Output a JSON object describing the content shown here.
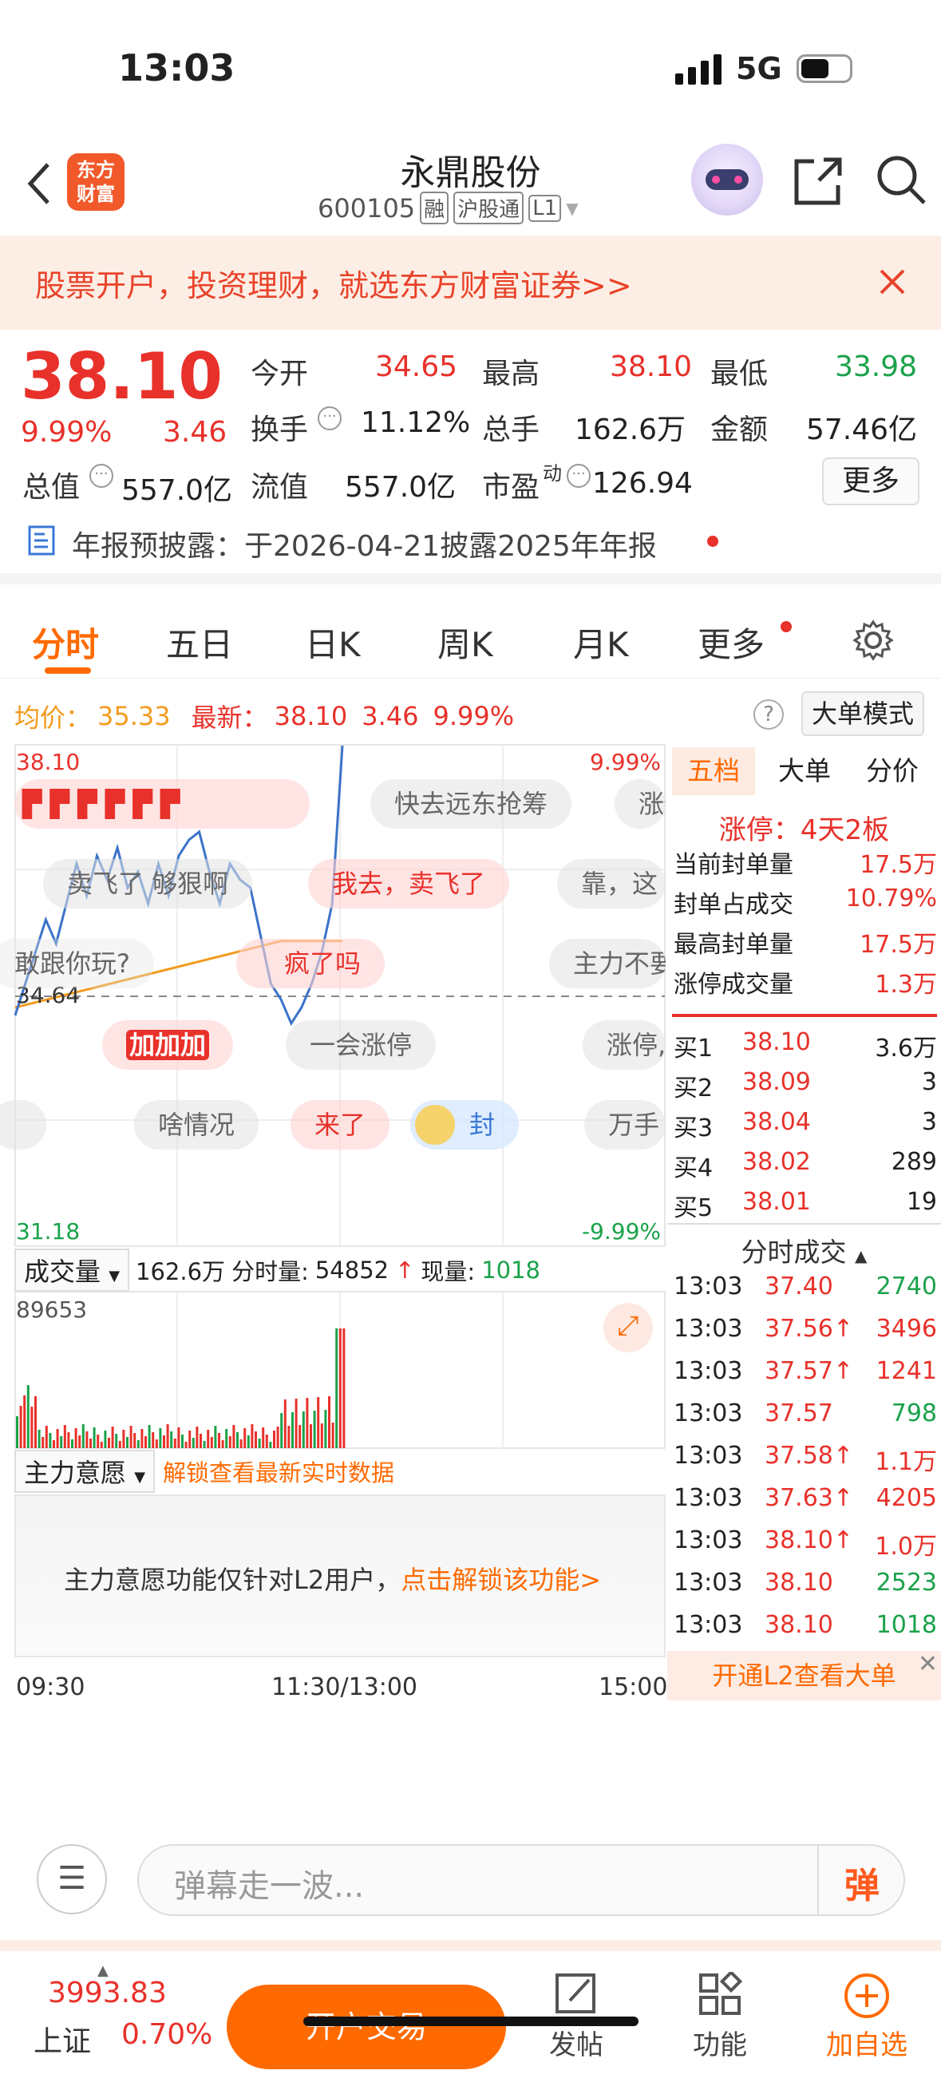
{
  "status": {
    "time": "13:03",
    "network": "5G"
  },
  "header": {
    "logo": "东方\n财富",
    "logo_line1": "东方",
    "logo_line2": "财富",
    "stock_name": "永鼎股份",
    "stock_code": "600105",
    "tags": [
      "融",
      "沪股通",
      "L1"
    ]
  },
  "banner": {
    "text": "股票开户，投资理财，就选东方财富证券>>"
  },
  "quote": {
    "price": "38.10",
    "pct": "9.99%",
    "change": "3.46",
    "fields": {
      "open_label": "今开",
      "open": "34.65",
      "high_label": "最高",
      "high": "38.10",
      "low_label": "最低",
      "low": "33.98",
      "turnover_label": "换手",
      "turnover": "11.12%",
      "volume_label": "总手",
      "volume": "162.6万",
      "amount_label": "金额",
      "amount": "57.46亿",
      "mktcap_label": "总值",
      "mktcap": "557.0亿",
      "float_label": "流值",
      "float": "557.0亿",
      "pe_label": "市盈",
      "pe_sup": "动",
      "pe": "126.94"
    },
    "more": "更多"
  },
  "announcement": {
    "text": "年报预披露：于2026-04-21披露2025年年报"
  },
  "tabs": [
    "分时",
    "五日",
    "日K",
    "周K",
    "月K",
    "更多"
  ],
  "chart_header": {
    "avg_label": "均价：",
    "avg": "35.33",
    "last_label": "最新：",
    "last": "38.10",
    "chg": "3.46",
    "pct": "9.99%",
    "mode": "大单模式"
  },
  "chart_axis": {
    "top_price": "38.10",
    "bottom_price": "31.18",
    "top_pct": "9.99%",
    "bottom_pct": "-9.99%",
    "prev_close": "34.64",
    "times": [
      "09:30",
      "11:30/13:00",
      "15:00"
    ]
  },
  "danmaku": [
    "快去远东抢筹",
    "涨停",
    "卖飞了 够狠啊",
    "我去，卖飞了",
    "靠，这",
    "敢跟你玩?",
    "疯了吗",
    "主力不要",
    "一会涨停",
    "涨停,",
    "加加加",
    "啥情况",
    "来了",
    "封",
    "万手"
  ],
  "volume": {
    "label": "成交量",
    "total": "162.6万",
    "period_label": "分时量:",
    "period": "54852",
    "now_label": "现量:",
    "now": "1018",
    "max": "89653"
  },
  "intent": {
    "label": "主力意愿",
    "unlock": "解锁查看最新实时数据",
    "notice": "主力意愿功能仅针对L2用户，",
    "notice_link": "点击解锁该功能>"
  },
  "right_tabs": [
    "五档",
    "大单",
    "分价"
  ],
  "limit": {
    "title": "涨停：4天2板",
    "rows": [
      {
        "label": "当前封单量",
        "value": "17.5万"
      },
      {
        "label": "封单占成交",
        "value": "10.79%"
      },
      {
        "label": "最高封单量",
        "value": "17.5万"
      },
      {
        "label": "涨停成交量",
        "value": "1.3万"
      }
    ]
  },
  "bids": [
    {
      "label": "买1",
      "price": "38.10",
      "vol": "3.6万"
    },
    {
      "label": "买2",
      "price": "38.09",
      "vol": "3"
    },
    {
      "label": "买3",
      "price": "38.04",
      "vol": "3"
    },
    {
      "label": "买4",
      "price": "38.02",
      "vol": "289"
    },
    {
      "label": "买5",
      "price": "38.01",
      "vol": "19"
    }
  ],
  "trades_title": "分时成交",
  "trades": [
    {
      "t": "13:03",
      "p": "37.40",
      "v": "2740",
      "c": "#1aa24a"
    },
    {
      "t": "13:03",
      "p": "37.56↑",
      "v": "3496",
      "c": "#e8312a"
    },
    {
      "t": "13:03",
      "p": "37.57↑",
      "v": "1241",
      "c": "#e8312a"
    },
    {
      "t": "13:03",
      "p": "37.57",
      "v": "798",
      "c": "#1aa24a"
    },
    {
      "t": "13:03",
      "p": "37.58↑",
      "v": "1.1万",
      "c": "#e8312a"
    },
    {
      "t": "13:03",
      "p": "37.63↑",
      "v": "4205",
      "c": "#e8312a"
    },
    {
      "t": "13:03",
      "p": "38.10↑",
      "v": "1.0万",
      "c": "#e8312a"
    },
    {
      "t": "13:03",
      "p": "38.10",
      "v": "2523",
      "c": "#1aa24a"
    },
    {
      "t": "13:03",
      "p": "38.10",
      "v": "1018",
      "c": "#1aa24a"
    }
  ],
  "l2_banner": "开通L2查看大单",
  "comment": {
    "placeholder": "弹幕走一波...",
    "send": "弹"
  },
  "index": {
    "value": "3993.83",
    "name": "上证",
    "pct": "0.70%"
  },
  "bottom_nav": {
    "trade": "开户交易",
    "post": "发帖",
    "func": "功能",
    "fav": "加自选"
  },
  "colors": {
    "up": "#e8312a",
    "down": "#1aa24a",
    "accent": "#ff6a00",
    "avg_line": "#f39a1e",
    "price_line": "#3b73c9"
  }
}
